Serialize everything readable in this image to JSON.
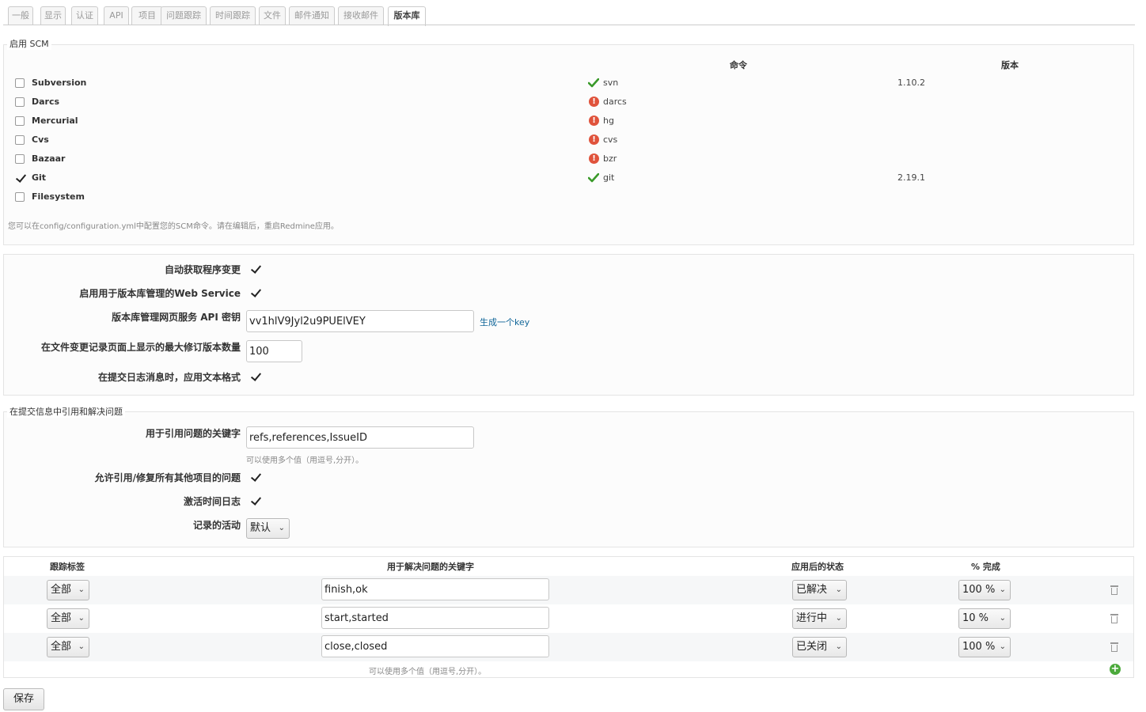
{
  "tabs": [
    "一般",
    "显示",
    "认证",
    "API",
    "项目",
    "问题跟踪",
    "时间跟踪",
    "文件",
    "邮件通知",
    "接收邮件",
    "版本库"
  ],
  "scm": {
    "legend": "启用 SCM",
    "col_command": "命令",
    "col_version": "版本",
    "items": [
      {
        "name": "Subversion",
        "enabled": false,
        "status": "ok",
        "command": "svn",
        "version": "1.10.2"
      },
      {
        "name": "Darcs",
        "enabled": false,
        "status": "error",
        "command": "darcs",
        "version": ""
      },
      {
        "name": "Mercurial",
        "enabled": false,
        "status": "error",
        "command": "hg",
        "version": ""
      },
      {
        "name": "Cvs",
        "enabled": false,
        "status": "error",
        "command": "cvs",
        "version": ""
      },
      {
        "name": "Bazaar",
        "enabled": false,
        "status": "error",
        "command": "bzr",
        "version": ""
      },
      {
        "name": "Git",
        "enabled": true,
        "status": "ok",
        "command": "git",
        "version": "2.19.1"
      },
      {
        "name": "Filesystem",
        "enabled": false,
        "status": "",
        "command": "",
        "version": ""
      }
    ],
    "note": "您可以在config/configuration.yml中配置您的SCM命令。请在编辑后，重启Redmine应用。"
  },
  "settings": {
    "autofetch_label": "自动获取程序变更",
    "ws_label": "启用用于版本库管理的Web Service",
    "api_key_label": "版本库管理网页服务 API 密钥",
    "api_key_value": "vv1hlV9Jyl2u9PUElVEY",
    "generate_key_link": "生成一个key",
    "max_rev_label": "在文件变更记录页面上显示的最大修订版本数量",
    "max_rev_value": "100",
    "text_format_label": "在提交日志消息时，应用文本格式"
  },
  "refs": {
    "legend": "在提交信息中引用和解决问题",
    "keywords_label": "用于引用问题的关键字",
    "keywords_value": "refs,references,IssueID",
    "keywords_hint": "可以使用多个值（用逗号,分开）。",
    "cross_project_label": "允许引用/修复所有其他项目的问题",
    "time_log_label": "激活时间日志",
    "activity_label": "记录的活动",
    "activity_value": "默认"
  },
  "fix_table": {
    "col_tracker": "跟踪标签",
    "col_keywords": "用于解决问题的关键字",
    "col_status": "应用后的状态",
    "col_done": "% 完成",
    "rows": [
      {
        "tracker": "全部",
        "keywords": "finish,ok",
        "status": "已解决",
        "done": "100 %"
      },
      {
        "tracker": "全部",
        "keywords": "start,started",
        "status": "进行中",
        "done": "10 %"
      },
      {
        "tracker": "全部",
        "keywords": "close,closed",
        "status": "已关闭",
        "done": "100 %"
      }
    ],
    "hint": "可以使用多个值（用逗号,分开）。"
  },
  "save_label": "保存"
}
